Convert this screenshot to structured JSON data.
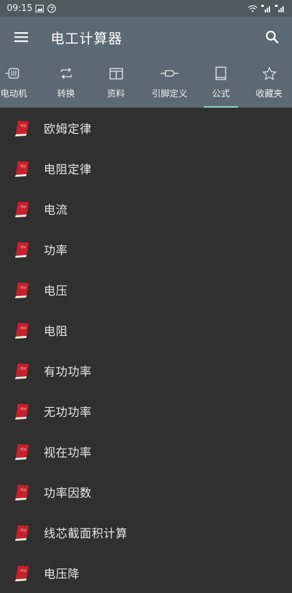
{
  "status_bar": {
    "time": "09:15",
    "left_icons": [
      "gallery-icon",
      "circle-badge-icon"
    ],
    "right_icons": [
      "wifi-icon",
      "signal-3g-icon",
      "signal-5g-icon"
    ]
  },
  "toolbar": {
    "title": "电工计算器",
    "menu_icon": "menu-icon",
    "search_icon": "search-icon"
  },
  "tabs": [
    {
      "label": "电动机",
      "icon": "motor-icon"
    },
    {
      "label": "转换",
      "icon": "convert-icon"
    },
    {
      "label": "资料",
      "icon": "table-icon"
    },
    {
      "label": "引脚定义",
      "icon": "pin-icon"
    },
    {
      "label": "公式",
      "icon": "book-icon",
      "active": true
    },
    {
      "label": "收藏夹",
      "icon": "star-icon"
    }
  ],
  "formulas": [
    {
      "label": "欧姆定律"
    },
    {
      "label": "电阻定律"
    },
    {
      "label": "电流"
    },
    {
      "label": "功率"
    },
    {
      "label": "电压"
    },
    {
      "label": "电阻"
    },
    {
      "label": "有功功率"
    },
    {
      "label": "无功功率"
    },
    {
      "label": "视在功率"
    },
    {
      "label": "功率因数"
    },
    {
      "label": "线芯截面积计算"
    },
    {
      "label": "电压降"
    }
  ],
  "colors": {
    "status_bar": "#4e5a60",
    "toolbar": "#5b6a72",
    "background": "#303030",
    "tab_indicator": "#9bd6d0",
    "book_red": "#c8202a"
  }
}
